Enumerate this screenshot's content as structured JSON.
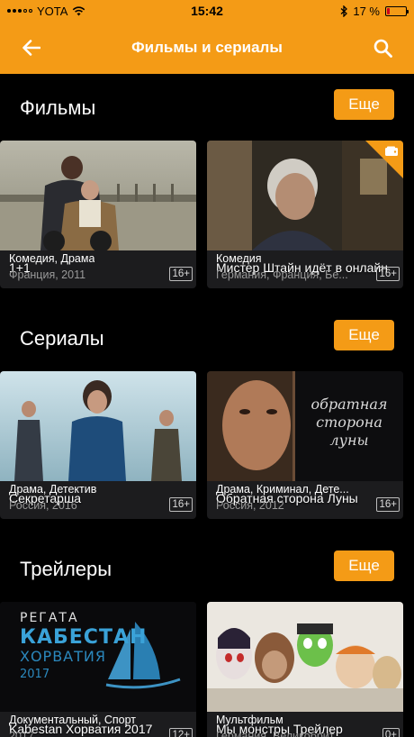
{
  "status": {
    "carrier": "YOTA",
    "time": "15:42",
    "battery": "17 %",
    "battery_level": 0.17
  },
  "nav": {
    "title": "Фильмы и сериалы"
  },
  "colors": {
    "accent": "#f49b16",
    "background": "#000000",
    "card": "#1c1c1e",
    "muted": "#9a9a9a"
  },
  "more_label": "Еще",
  "sections": [
    {
      "title": "Фильмы",
      "cards": [
        {
          "title": "1+1",
          "genre": "Комедия, Драма",
          "country": "Франция, 2011",
          "age": "16+"
        },
        {
          "title": "Мистер Штайн идёт в онлайн",
          "genre": "Комедия",
          "country": "Германия, Франция, Бе...",
          "age": "16+",
          "badge_icon": "wallet-icon"
        }
      ]
    },
    {
      "title": "Сериалы",
      "cards": [
        {
          "title": "Секретарша",
          "genre": "Драма, Детектив",
          "country": "Россия, 2016",
          "age": "16+"
        },
        {
          "title": "Обратная сторона Луны",
          "genre": "Драма, Криминал, Дете...",
          "country": "Россия, 2012",
          "age": "16+",
          "poster_text": "обратная сторона луны"
        }
      ]
    },
    {
      "title": "Трейлеры",
      "cards": [
        {
          "title": "Kabestan Хорватия 2017",
          "genre": "Документальный, Спорт",
          "country": "2017",
          "age": "12+",
          "poster_text": [
            "РЕГАТА",
            "КАБЕСТАН",
            "ХОРВАТИЯ",
            "2017"
          ]
        },
        {
          "title": "Мы монстры Трейлер",
          "genre": "Мультфильм",
          "country": "Германия, Великобрит...",
          "age": "0+"
        }
      ]
    }
  ]
}
